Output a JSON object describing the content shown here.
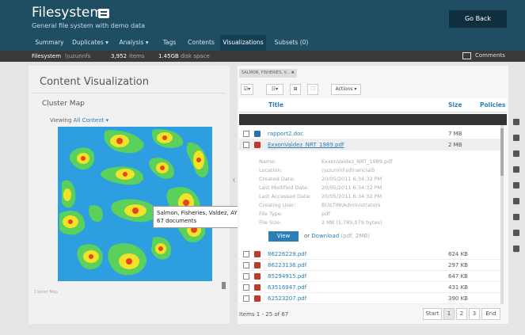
{
  "header": {
    "title": "Filesystem",
    "subtitle": "General file system with demo data",
    "go_back": "Go Back"
  },
  "tabs": [
    {
      "label": "Summary"
    },
    {
      "label": "Duplicates ▾"
    },
    {
      "label": "Analysis ▾"
    },
    {
      "label": "Tags"
    },
    {
      "label": "Contents"
    },
    {
      "label": "Visualizations",
      "active": true
    },
    {
      "label": "Subsets (0)"
    }
  ],
  "stats": {
    "name": "Filesystem",
    "host": "\\\\uzunnfs",
    "items": "3,952",
    "items_label": "items",
    "size": "1.45GB",
    "size_label": "disk space",
    "comments": "Comments"
  },
  "left": {
    "title": "Content Visualization",
    "cluster_map": "Cluster Map",
    "viewing": "Viewing",
    "viewing_value": "All Content ▾",
    "tooltip_line1": "Salmon, Fisheries, Valdez, AYK",
    "tooltip_line2": "67 documents",
    "footer": "Cluster Map"
  },
  "right": {
    "filter_chip": "SALMON, FISHERIES, V... ✖",
    "actions": "Actions ▾",
    "columns": {
      "title": "Title",
      "size": "Size",
      "policies": "Policies"
    },
    "rows": [
      {
        "name": "rapport2.doc",
        "size": "7 MB",
        "type": "doc"
      },
      {
        "name": "ExxonValdez_NRT_1989.pdf",
        "size": "2 MB",
        "type": "pdf",
        "selected": true
      },
      {
        "name": "86226229.pdf",
        "size": "624 KB",
        "type": "pdf"
      },
      {
        "name": "86223136.pdf",
        "size": "297 KB",
        "type": "pdf"
      },
      {
        "name": "85294915.pdf",
        "size": "647 KB",
        "type": "pdf"
      },
      {
        "name": "63516947.pdf",
        "size": "431 KB",
        "type": "pdf"
      },
      {
        "name": "62523207.pdf",
        "size": "390 KB",
        "type": "pdf"
      }
    ],
    "details": [
      {
        "label": "Name:",
        "value": "ExxonValdez_NRT_1989.pdf"
      },
      {
        "label": "Location:",
        "value": "\\\\uzunn\\Fs\\financial5"
      },
      {
        "label": "Created Date:",
        "value": "20/05/2011 6:34:32 PM"
      },
      {
        "label": "Last Modified Date:",
        "value": "20/05/2011 6:34:32 PM"
      },
      {
        "label": "Last Accessed Date:",
        "value": "20/05/2011 6:34:32 PM"
      },
      {
        "label": "Creating User:",
        "value": "BUILTIN\\Administrators"
      },
      {
        "label": "File Type:",
        "value": "pdf"
      },
      {
        "label": "File Size:",
        "value": "2 MB (1,785,079 bytes)"
      }
    ],
    "view_btn": "View",
    "or": "or",
    "download": "Download",
    "download_suffix": "(pdf, 2MB)",
    "footer": "Items 1 - 25 of 67",
    "pager": [
      "Start",
      "1",
      "2",
      "3",
      "End"
    ]
  },
  "colors": {
    "header": "#1f4e63",
    "accent": "#2a7fb8",
    "map_bg": "#2d9fe0"
  }
}
